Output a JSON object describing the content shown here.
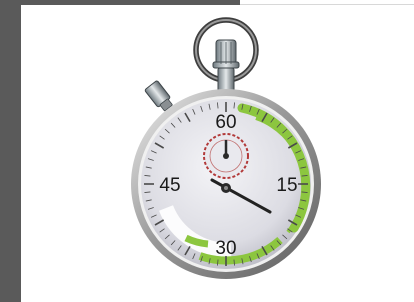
{
  "stopwatch": {
    "dial_labels": {
      "top": "60",
      "right": "15",
      "bottom": "30",
      "left": "45"
    },
    "colors": {
      "accent": "#8cc63f",
      "frame": "#5a5a5a",
      "subdial": "#b23a3a"
    },
    "icon": "stopwatch-icon"
  }
}
